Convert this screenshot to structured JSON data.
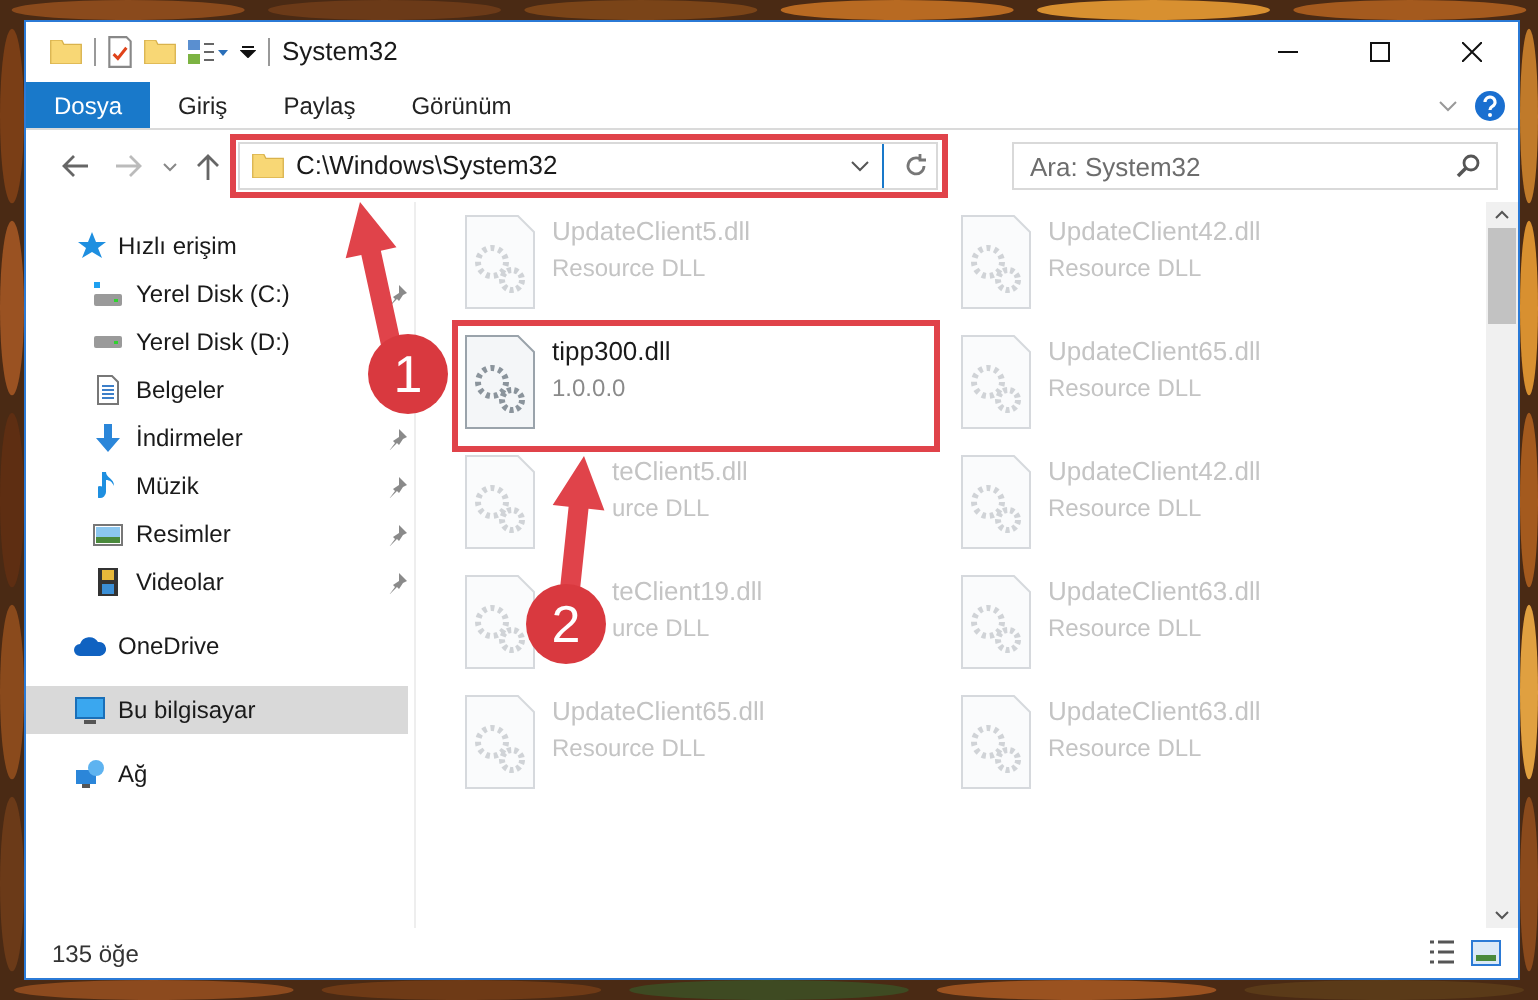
{
  "window": {
    "title": "System32"
  },
  "ribbon_tabs": [
    {
      "label": "Dosya",
      "selected": true
    },
    {
      "label": "Giriş",
      "selected": false
    },
    {
      "label": "Paylaş",
      "selected": false
    },
    {
      "label": "Görünüm",
      "selected": false
    }
  ],
  "address_bar": {
    "path": "C:\\Windows\\System32"
  },
  "search": {
    "placeholder": "Ara: System32"
  },
  "sidebar": {
    "items": [
      {
        "label": "Hızlı erişim",
        "kind": "group",
        "pinned": false,
        "selected": false
      },
      {
        "label": "Yerel Disk (C:)",
        "kind": "child",
        "pinned": true,
        "selected": false
      },
      {
        "label": "Yerel Disk (D:)",
        "kind": "child",
        "selected": false
      },
      {
        "label": "Belgeler",
        "kind": "child",
        "selected": false
      },
      {
        "label": "İndirmeler",
        "kind": "child",
        "pinned": true,
        "selected": false
      },
      {
        "label": "Müzik",
        "kind": "child",
        "pinned": true,
        "selected": false
      },
      {
        "label": "Resimler",
        "kind": "child",
        "pinned": true,
        "selected": false
      },
      {
        "label": "Videolar",
        "kind": "child",
        "pinned": true,
        "selected": false
      },
      {
        "label": "OneDrive",
        "kind": "group",
        "pinned": false,
        "selected": false
      },
      {
        "label": "Bu bilgisayar",
        "kind": "group",
        "pinned": false,
        "selected": true
      },
      {
        "label": "Ağ",
        "kind": "group",
        "pinned": false,
        "selected": false
      }
    ]
  },
  "files": [
    {
      "name": "UpdateClient5.dll",
      "detail": "Resource DLL",
      "faded": true,
      "covered": false
    },
    {
      "name": "UpdateClient42.dll",
      "detail": "Resource DLL",
      "faded": true,
      "covered": false
    },
    {
      "name": "tipp300.dll",
      "detail": "1.0.0.0",
      "faded": false
    },
    {
      "name": "UpdateClient65.dll",
      "detail": "Resource DLL",
      "faded": true,
      "covered": false
    },
    {
      "name": "teClient5.dll",
      "detail": "urce DLL",
      "faded": true,
      "covered": true
    },
    {
      "name": "UpdateClient42.dll",
      "detail": "Resource DLL",
      "faded": true,
      "covered": false
    },
    {
      "name": "teClient19.dll",
      "detail": "urce DLL",
      "faded": true,
      "covered": true
    },
    {
      "name": "UpdateClient63.dll",
      "detail": "Resource DLL",
      "faded": true,
      "covered": false
    },
    {
      "name": "UpdateClient65.dll",
      "detail": "Resource DLL",
      "faded": true,
      "covered": false
    },
    {
      "name": "UpdateClient63.dll",
      "detail": "Resource DLL",
      "faded": true,
      "covered": false
    }
  ],
  "status_bar": {
    "count": "135 öğe"
  },
  "annotations": [
    {
      "number": "1"
    },
    {
      "number": "2"
    }
  ]
}
